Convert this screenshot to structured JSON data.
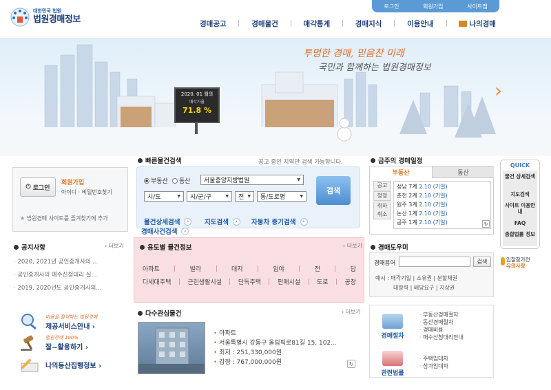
{
  "header": {
    "logo_sub": "대한민국 법원",
    "logo_main": "법원경매정보",
    "util": [
      "로그인",
      "회원가입",
      "사이트맵"
    ],
    "gnb": [
      "경매공고",
      "경매물건",
      "매각통계",
      "경매지식",
      "이용안내",
      "나의경매"
    ]
  },
  "banner": {
    "slogan1": "투명한 경매, 믿음찬 미래",
    "slogan2": "국민과 함께하는 법원경매정보",
    "rate_title": "2020. 01 월의",
    "rate_label": "매각가율",
    "rate_value": "71.8 %",
    "next_arrow": "›"
  },
  "login": {
    "button": "로그인",
    "join": "회원가입",
    "find": "아이디 · 비밀번호찾기",
    "favorite": "법원경매 사이트를 즐겨찾기에 추가"
  },
  "notice": {
    "title": "공지사항",
    "more": "더보기",
    "items": [
      "2020, 2021년 공인중개사의 ...",
      "공인중개사의 매수신청대리 실...",
      "2019, 2020년도 공인중개사의..."
    ]
  },
  "side_links": [
    {
      "small": "비용을 절약하는 법원경매",
      "big": "제공서비스안내 ›"
    },
    {
      "small": "법원경매 100%",
      "big": "잘~활용하기 ›"
    },
    {
      "small": "",
      "big": "나의동산집행정보 ›"
    }
  ],
  "quick_search": {
    "title": "빠른물건검색",
    "note": "공고 중인 지역만 검색 가능합니다.",
    "radio1": "부동산",
    "radio2": "동산",
    "court": "서울중앙지방법원",
    "sido": "시/도",
    "sigungu": "시/군/구",
    "jeon": "전",
    "dong": "동/도로명",
    "search": "검색",
    "links": [
      "물건상세검색",
      "지도검색",
      "자동차 중기검색",
      "경매사건검색"
    ]
  },
  "usage": {
    "title": "용도별 물건정보",
    "more": "더보기",
    "row1": [
      "아파트",
      "빌라",
      "대지",
      "임야",
      "전",
      "답"
    ],
    "row2": [
      "다세대주택",
      "근린생활시설",
      "단독주택",
      "판매시설",
      "도로",
      "공장"
    ]
  },
  "interest": {
    "title": "다수관심물건",
    "more": "더보기",
    "type": "아파트",
    "address": "서울특별시 강동구 올림픽로81길 15, 102...",
    "min_price": "최저 : 251,330,000원",
    "appraisal": "감정 : 767,000,000원"
  },
  "schedule": {
    "title": "금주의 경매일정",
    "tab1": "부동산",
    "tab2": "동산",
    "side1": "공고",
    "side2": "정정",
    "side3": "취하 취소",
    "items": [
      {
        "court": "성남 7계",
        "date": "2.10 (기일)"
      },
      {
        "court": "춘천 2계",
        "date": "2.10 (기일)"
      },
      {
        "court": "원주 3계",
        "date": "2.10 (기일)"
      },
      {
        "court": "논산 1계",
        "date": "2.10 (기일)"
      },
      {
        "court": "공주 1계",
        "date": "2.10 (기일)"
      }
    ]
  },
  "dictionary": {
    "title": "경매도우미",
    "label": "경매용어",
    "button": "검색",
    "example_label": "예시 :",
    "examples1": "매각기일 | 소유권 | 분할채권",
    "examples2": "대항력 | 배당요구 | 지상권"
  },
  "procedures": {
    "label1": "경매절차",
    "list1": [
      "부동산경매절차",
      "동산경매절차",
      "경매비용",
      "매수신청대리안내"
    ],
    "label2": "관련법률",
    "list2": [
      "주택임대차",
      "상가임대차"
    ]
  },
  "quick": {
    "title": "QUICK",
    "items": [
      "물건 상세검색",
      "지도검색",
      "사이트 이용안내",
      "FAQ",
      "종합법률 정보"
    ]
  },
  "bid_note": {
    "line1": "입찰참가전",
    "line2": "유의사항"
  },
  "colors": {
    "brand": "#1c3f7a",
    "accent": "#e8751a",
    "pink_box": "#f9dfe3",
    "search_blue": "#4d8ed0"
  }
}
